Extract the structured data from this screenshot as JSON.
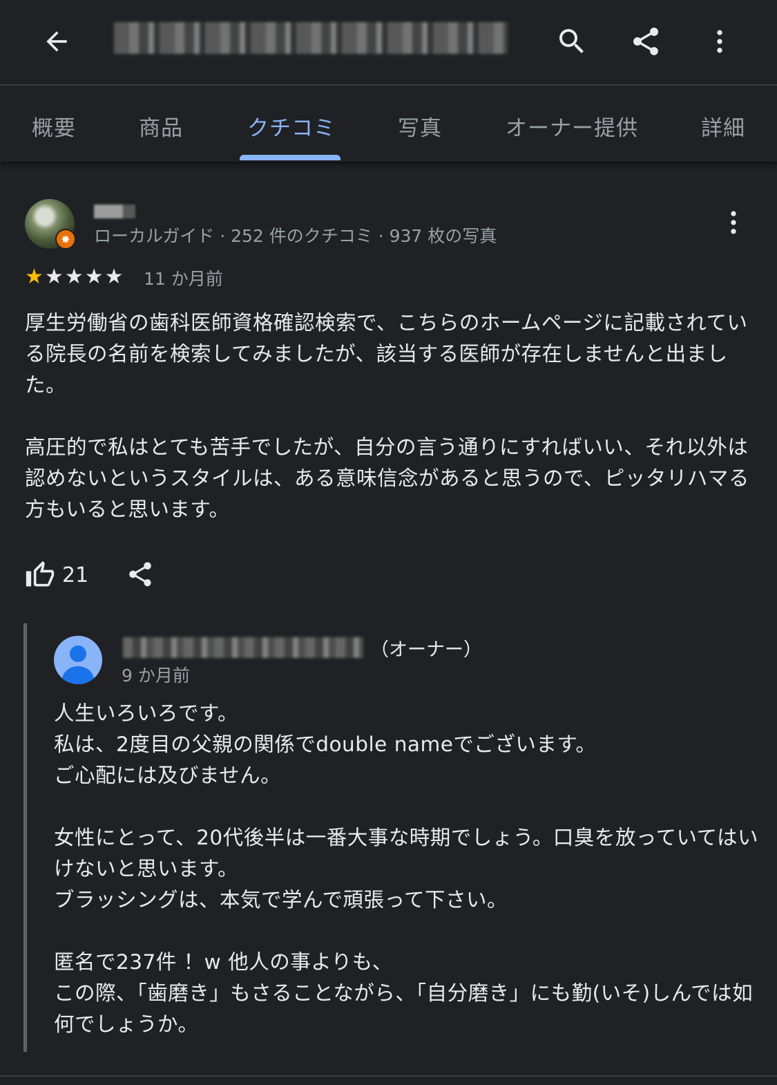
{
  "tabs": [
    "概要",
    "商品",
    "クチコミ",
    "写真",
    "オーナー提供",
    "詳細"
  ],
  "active_tab": "クチコミ",
  "review": {
    "meta": "ローカルガイド · 252 件のクチコミ · 937 枚の写真",
    "rating": 1,
    "rating_max": 5,
    "date": "11 か月前",
    "paragraphs": [
      "厚生労働省の歯科医師資格確認検索で、こちらのホームページに記載されている院長の名前を検索してみましたが、該当する医師が存在しませんと出ました。",
      "高圧的で私はとても苦手でしたが、自分の言う通りにすればいい、それ以外は認めないというスタイルは、ある意味信念があると思うので、ピッタリハマる方もいると思います。"
    ],
    "like_count": "21"
  },
  "owner_reply": {
    "owner_label": "（オーナー）",
    "date": "9 か月前",
    "paragraphs": [
      "人生いろいろです。\n私は、2度目の父親の関係でdouble nameでございます。\nご心配には及びません。",
      "女性にとって、20代後半は一番大事な時期でしょう。口臭を放っていてはいけないと思います。\nブラッシングは、本気で学んで頑張って下さい。",
      "匿名で237件 ！w 他人の事よりも、\nこの際、「歯磨き」もさることながら、「自分磨き」にも勤(いそ)しんでは如何でしょうか。"
    ]
  },
  "icons": {
    "back": "arrow-back-icon",
    "search": "search-icon",
    "share": "share-icon",
    "more": "more-vert-icon",
    "like": "thumb-up-icon",
    "local_guide_badge": "local-guide-badge-icon",
    "star": "star-icon"
  },
  "colors": {
    "background": "#202124",
    "accent": "#8ab4f8",
    "star": "#fbbc04",
    "text": "#e8eaed",
    "secondary_text": "#9aa0a6",
    "badge": "#e8710a"
  }
}
